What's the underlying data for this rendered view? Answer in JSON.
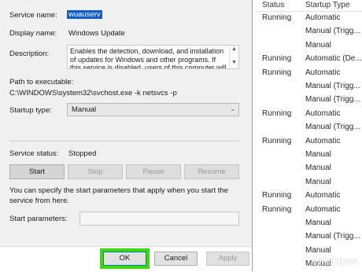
{
  "dialog": {
    "service_name_label": "Service name:",
    "service_name_value": "wuauserv",
    "display_name_label": "Display name:",
    "display_name_value": "Windows Update",
    "description_label": "Description:",
    "description_text": "Enables the detection, download, and installation of updates for Windows and other programs. If this service is disabled, users of this computer will not be",
    "path_label": "Path to executable:",
    "path_value": "C:\\WINDOWS\\system32\\svchost.exe -k netsvcs -p",
    "startup_type_label": "Startup type:",
    "startup_type_value": "Manual",
    "service_status_label": "Service status:",
    "service_status_value": "Stopped",
    "buttons": {
      "start": "Start",
      "stop": "Stop",
      "pause": "Pause",
      "resume": "Resume"
    },
    "hint_text": "You can specify the start parameters that apply when you start the service from here.",
    "start_params_label": "Start parameters:",
    "start_params_value": "",
    "footer": {
      "ok": "OK",
      "cancel": "Cancel",
      "apply": "Apply"
    }
  },
  "services_list": {
    "headers": {
      "status": "Status",
      "startup": "Startup Type"
    },
    "rows": [
      {
        "status": "Running",
        "startup": "Automatic"
      },
      {
        "status": "",
        "startup": "Manual (Trigg..."
      },
      {
        "status": "",
        "startup": "Manual"
      },
      {
        "status": "Running",
        "startup": "Automatic (De..."
      },
      {
        "status": "Running",
        "startup": "Automatic"
      },
      {
        "status": "",
        "startup": "Manual (Trigg..."
      },
      {
        "status": "",
        "startup": "Manual (Trigg..."
      },
      {
        "status": "Running",
        "startup": "Automatic"
      },
      {
        "status": "",
        "startup": "Manual (Trigg..."
      },
      {
        "status": "Running",
        "startup": "Automatic"
      },
      {
        "status": "",
        "startup": "Manual"
      },
      {
        "status": "",
        "startup": "Manual"
      },
      {
        "status": "",
        "startup": "Manual"
      },
      {
        "status": "Running",
        "startup": "Automatic"
      },
      {
        "status": "Running",
        "startup": "Automatic"
      },
      {
        "status": "",
        "startup": "Manual"
      },
      {
        "status": "",
        "startup": "Manual (Trigg..."
      },
      {
        "status": "",
        "startup": "Manual"
      },
      {
        "status": "",
        "startup": "Manual"
      }
    ]
  },
  "watermark": {
    "prefix": "wiki",
    "suffix": "How"
  },
  "colors": {
    "highlight": "#33e000",
    "selection": "#0a5bd6"
  }
}
